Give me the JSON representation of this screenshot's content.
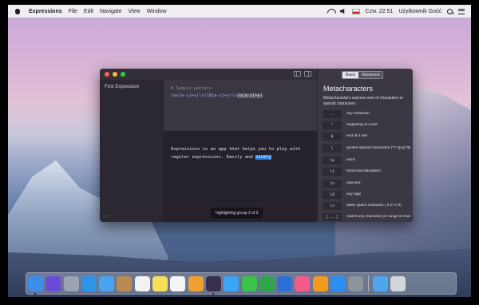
{
  "menubar": {
    "app_name": "Expressions",
    "menus": [
      "File",
      "Edit",
      "Navigate",
      "View",
      "Window"
    ],
    "clock": "Czw. 22:51",
    "user": "Użytkownik Gość"
  },
  "window": {
    "sidebar": {
      "items": [
        "First Expression"
      ],
      "footer": "+  —"
    },
    "editor": {
      "comment": "# Sample pattern",
      "pattern_parts": [
        {
          "text": "(ex[a-z]+s)\\s(\\B[a-z]+y)\\s",
          "cls": "g1"
        },
        {
          "text": "(n[a-z]+y)",
          "cls": "hl"
        }
      ]
    },
    "test": {
      "line1": "Expressions is an app that helps you to play with",
      "line2_before": "regular expressions. Easily and ",
      "line2_match": "nicely"
    },
    "status": "highlighting group 3 of 3",
    "reference": {
      "tabs": {
        "basic": "Basic",
        "advanced": "Advanced"
      },
      "title": "Metacharacters",
      "description": "Metacharacters express sets of characters or special characters.",
      "rows": [
        {
          "key": ".",
          "desc": "any character"
        },
        {
          "key": "^",
          "desc": "beginning of a line"
        },
        {
          "key": "$",
          "desc": "end of a line"
        },
        {
          "key": "\\",
          "desc": "quotes special characters (*?+[](){}^$|\\./)"
        },
        {
          "key": "\\w",
          "desc": "word"
        },
        {
          "key": "\\t",
          "desc": "horizontal tabulation"
        },
        {
          "key": "\\n",
          "desc": "new line"
        },
        {
          "key": "\\d",
          "desc": "any digit"
        },
        {
          "key": "\\s",
          "desc": "white space character ( \\t \\n \\r \\f)"
        },
        {
          "key": "[...]",
          "desc": "match any character (or range of characters) in brackets"
        }
      ]
    }
  },
  "dock": {
    "apps": [
      {
        "name": "finder-icon",
        "color": "#3c8ee8"
      },
      {
        "name": "siri-icon",
        "color": "#6b4ad6"
      },
      {
        "name": "launchpad-icon",
        "color": "#9ca4b4"
      },
      {
        "name": "safari-icon",
        "color": "#2f93e8"
      },
      {
        "name": "mail-icon",
        "color": "#4aa3f0"
      },
      {
        "name": "contacts-icon",
        "color": "#b98a52"
      },
      {
        "name": "calendar-icon",
        "color": "#f3f3f3"
      },
      {
        "name": "notes-icon",
        "color": "#f7df5a"
      },
      {
        "name": "reminders-icon",
        "color": "#f5f5f5"
      },
      {
        "name": "photos-icon",
        "color": "#f0a030"
      },
      {
        "name": "expressions-icon",
        "color": "#3a2f4a"
      },
      {
        "name": "messages-icon",
        "color": "#3aa5f5"
      },
      {
        "name": "facetime-icon",
        "color": "#3cc24a"
      },
      {
        "name": "numbers-icon",
        "color": "#2ea44f"
      },
      {
        "name": "keynote-icon",
        "color": "#2b6fd9"
      },
      {
        "name": "itunes-icon",
        "color": "#f25b8a"
      },
      {
        "name": "ibooks-icon",
        "color": "#f29a1e"
      },
      {
        "name": "app-store-icon",
        "color": "#2a8ff0"
      },
      {
        "name": "system-preferences-icon",
        "color": "#8f939b"
      }
    ],
    "trailing": [
      {
        "name": "downloads-folder-icon",
        "color": "#4ea7ee"
      },
      {
        "name": "trash-icon",
        "color": "#d3d6dc"
      }
    ]
  }
}
